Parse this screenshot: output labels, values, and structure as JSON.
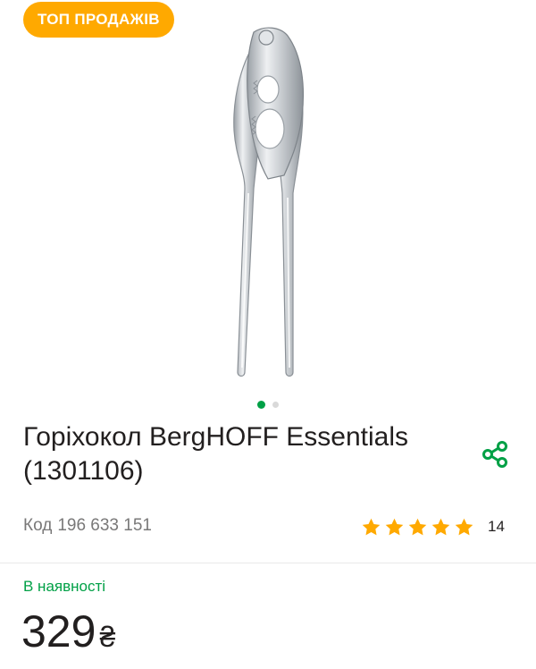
{
  "badge": {
    "label": "ТОП ПРОДАЖІВ"
  },
  "gallery": {
    "image_alt": "Горіхокол BergHOFF Essentials",
    "slide_count": 2,
    "active_slide": 1
  },
  "product": {
    "title": "Горіхокол BergHOFF Essentials (1301106)",
    "code_label": "Код",
    "code_value": "196 633 151",
    "rating": 5,
    "review_count": "14",
    "availability": "В наявності",
    "price": "329",
    "currency": "₴"
  },
  "colors": {
    "accent_green": "#00a046",
    "badge_orange": "#ffa900",
    "star_orange": "#ffa900",
    "text": "#221f1f",
    "muted": "#797878"
  },
  "icons": {
    "share": "share-icon",
    "star": "star-icon"
  }
}
